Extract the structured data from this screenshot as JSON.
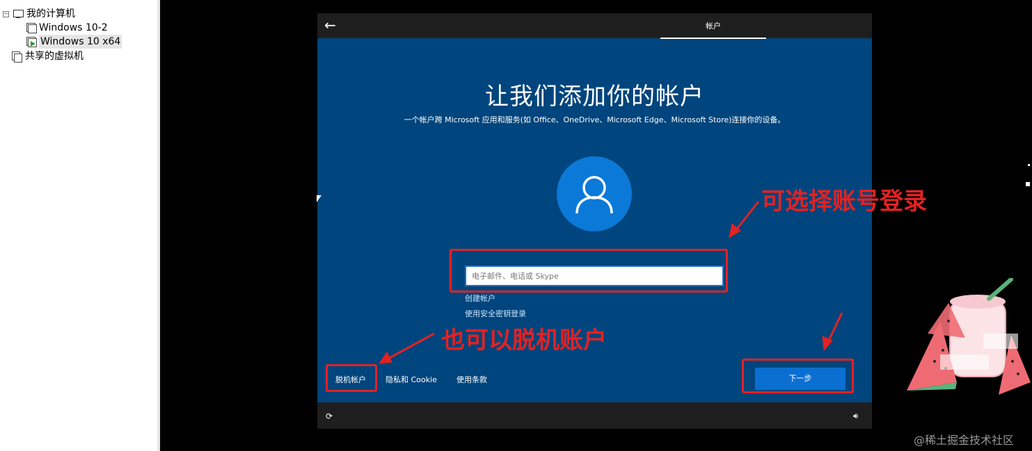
{
  "vm_library": {
    "items": [
      {
        "label": "我的计算机",
        "icon": "computer-icon",
        "expanded": true
      },
      {
        "label": "Windows 10-2",
        "icon": "vm-icon"
      },
      {
        "label": "Windows 10 x64",
        "icon": "vm-running-icon",
        "selected": true
      },
      {
        "label": "共享的虚拟机",
        "icon": "shared-vm-icon"
      }
    ]
  },
  "setup": {
    "tab_title": "帐户",
    "heading": "让我们添加你的帐户",
    "subtitle": "一个帐户跨 Microsoft 应用和服务(如 Office、OneDrive、Microsoft Edge、Microsoft Store)连接你的设备。",
    "input_placeholder": "电子邮件、电话或 Skype",
    "input_value": "",
    "create_account": "创建帐户",
    "security_key_signin": "使用安全密钥登录",
    "offline_account": "脱机帐户",
    "privacy_cookie": "隐私和 Cookie",
    "terms": "使用条款",
    "next": "下一步"
  },
  "annotations": {
    "account_login": "可选择账号登录",
    "offline": "也可以脱机账户"
  },
  "watermark": "@稀土掘金技术社区",
  "colors": {
    "setup_background": "#00457d",
    "avatar": "#0b79d8",
    "next_button": "#0b6fd1",
    "annotation": "#e32222",
    "bar": "#1e1e1e"
  }
}
